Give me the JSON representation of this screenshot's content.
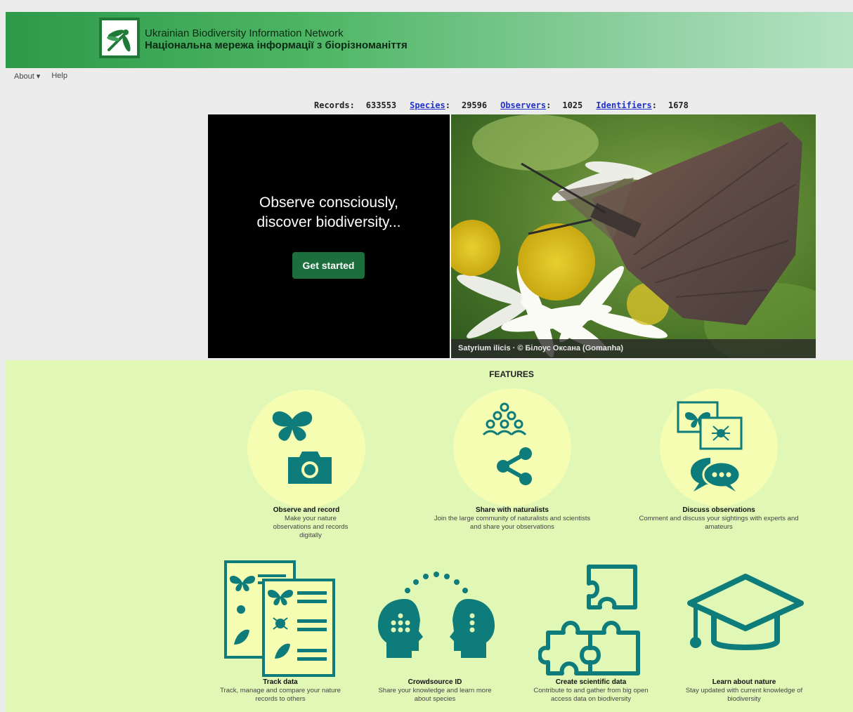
{
  "header": {
    "title_en": "Ukrainian Biodiversity Information Network",
    "title_ua": "Національна мережа інформації з біорізноманіття"
  },
  "menu": {
    "about": "About ▾",
    "help": "Help"
  },
  "stats": {
    "records_label": "Records:",
    "records_value": "633553",
    "species_label": "Species",
    "species_value": "29596",
    "observers_label": "Observers",
    "observers_value": "1025",
    "identifiers_label": "Identifiers",
    "identifiers_value": "1678"
  },
  "hero": {
    "line1": "Observe consciously,",
    "line2": "discover biodiversity...",
    "button": "Get started",
    "photo_caption": "Satyrium ilicis · © Білоус Оксана (Gomanha)"
  },
  "features": {
    "heading": "FEATURES",
    "items": [
      {
        "title": "Observe and record",
        "desc": "Make your nature observations and records digitally"
      },
      {
        "title": "Share with naturalists",
        "desc": "Join the large community of naturalists and scientists and share your observations"
      },
      {
        "title": "Discuss observations",
        "desc": "Comment and discuss your sightings with experts and amateurs"
      },
      {
        "title": "Track data",
        "desc": "Track, manage and compare your nature records to others"
      },
      {
        "title": "Crowdsource ID",
        "desc": "Share your knowledge and learn more about species"
      },
      {
        "title": "Create scientific data",
        "desc": "Contribute to and gather from big open access data on biodiversity"
      },
      {
        "title": "Learn about nature",
        "desc": "Stay updated with current knowledge of biodiversity"
      }
    ]
  },
  "colors": {
    "teal": "#0e7c7b",
    "banner": "#2d9a4a",
    "features_bg": "#e0f7b6",
    "button": "#1c6e3c"
  }
}
